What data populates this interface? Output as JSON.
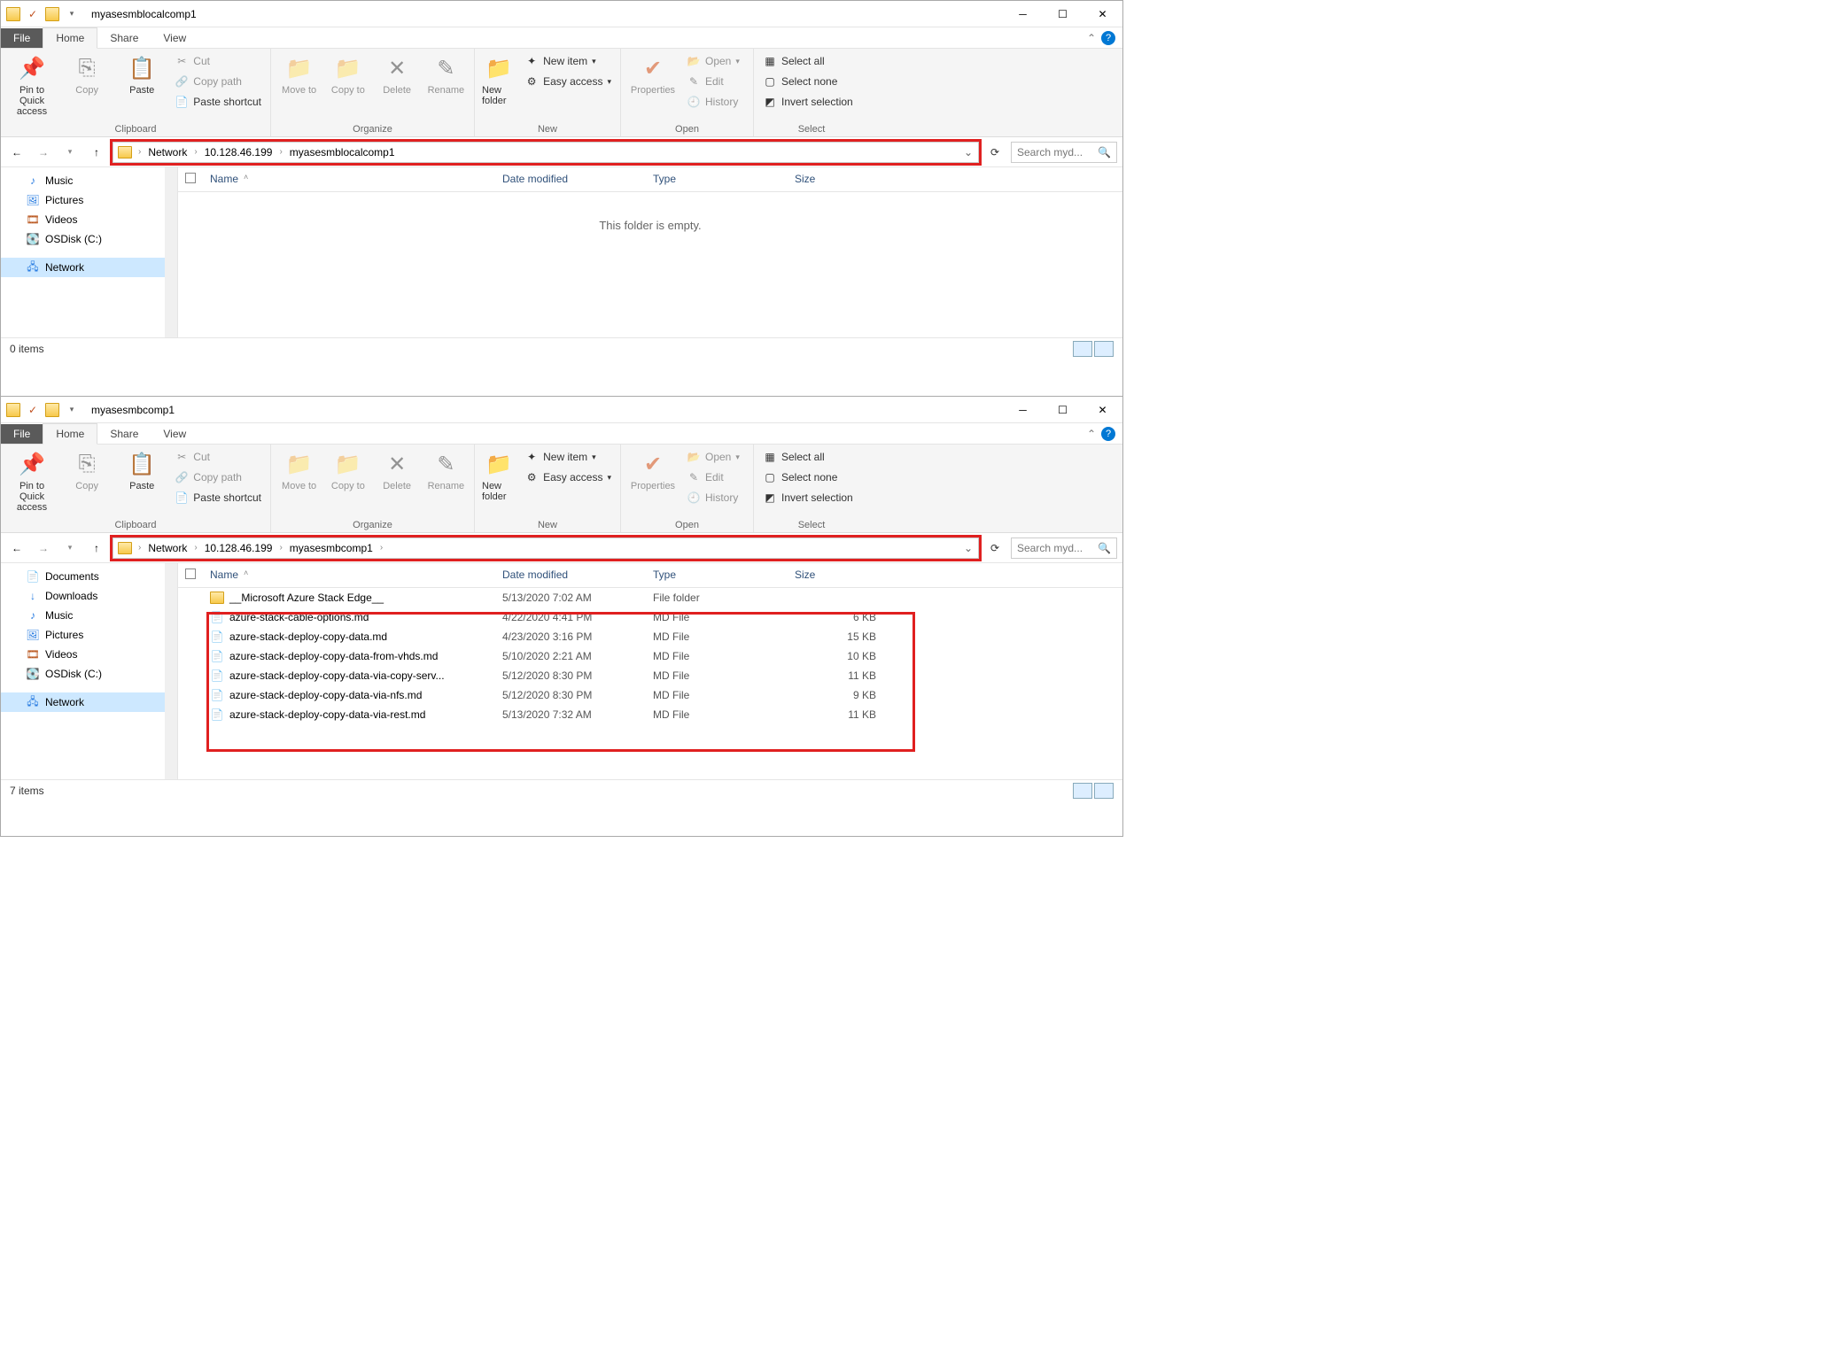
{
  "win1": {
    "title": "myasesmblocalcomp1",
    "tabs": {
      "file": "File",
      "home": "Home",
      "share": "Share",
      "view": "View"
    },
    "ribbon": {
      "clipboard": {
        "label": "Clipboard",
        "pin": "Pin to Quick access",
        "copy": "Copy",
        "paste": "Paste",
        "cut": "Cut",
        "copypath": "Copy path",
        "pasteshort": "Paste shortcut"
      },
      "organize": {
        "label": "Organize",
        "moveto": "Move to",
        "copyto": "Copy to",
        "delete": "Delete",
        "rename": "Rename"
      },
      "new": {
        "label": "New",
        "newfolder": "New folder",
        "newitem": "New item",
        "easy": "Easy access"
      },
      "open": {
        "label": "Open",
        "properties": "Properties",
        "open": "Open",
        "edit": "Edit",
        "history": "History"
      },
      "select": {
        "label": "Select",
        "all": "Select all",
        "none": "Select none",
        "invert": "Invert selection"
      }
    },
    "breadcrumb": [
      "Network",
      "10.128.46.199",
      "myasesmblocalcomp1"
    ],
    "search_placeholder": "Search myd...",
    "sidebar": {
      "music": "Music",
      "pictures": "Pictures",
      "videos": "Videos",
      "osdisk": "OSDisk (C:)",
      "network": "Network"
    },
    "cols": {
      "name": "Name",
      "date": "Date modified",
      "type": "Type",
      "size": "Size"
    },
    "empty": "This folder is empty.",
    "status": "0 items"
  },
  "win2": {
    "title": "myasesmbcomp1",
    "breadcrumb": [
      "Network",
      "10.128.46.199",
      "myasesmbcomp1"
    ],
    "search_placeholder": "Search myd...",
    "sidebar": {
      "documents": "Documents",
      "downloads": "Downloads",
      "music": "Music",
      "pictures": "Pictures",
      "videos": "Videos",
      "osdisk": "OSDisk (C:)",
      "network": "Network"
    },
    "rows": [
      {
        "name": "__Microsoft Azure Stack Edge__",
        "date": "5/13/2020 7:02 AM",
        "type": "File folder",
        "size": ""
      },
      {
        "name": "azure-stack-cable-options.md",
        "date": "4/22/2020 4:41 PM",
        "type": "MD File",
        "size": "6 KB"
      },
      {
        "name": "azure-stack-deploy-copy-data.md",
        "date": "4/23/2020 3:16 PM",
        "type": "MD File",
        "size": "15 KB"
      },
      {
        "name": "azure-stack-deploy-copy-data-from-vhds.md",
        "date": "5/10/2020 2:21 AM",
        "type": "MD File",
        "size": "10 KB"
      },
      {
        "name": "azure-stack-deploy-copy-data-via-copy-serv...",
        "date": "5/12/2020 8:30 PM",
        "type": "MD File",
        "size": "11 KB"
      },
      {
        "name": "azure-stack-deploy-copy-data-via-nfs.md",
        "date": "5/12/2020 8:30 PM",
        "type": "MD File",
        "size": "9 KB"
      },
      {
        "name": "azure-stack-deploy-copy-data-via-rest.md",
        "date": "5/13/2020 7:32 AM",
        "type": "MD File",
        "size": "11 KB"
      }
    ],
    "status": "7 items"
  }
}
